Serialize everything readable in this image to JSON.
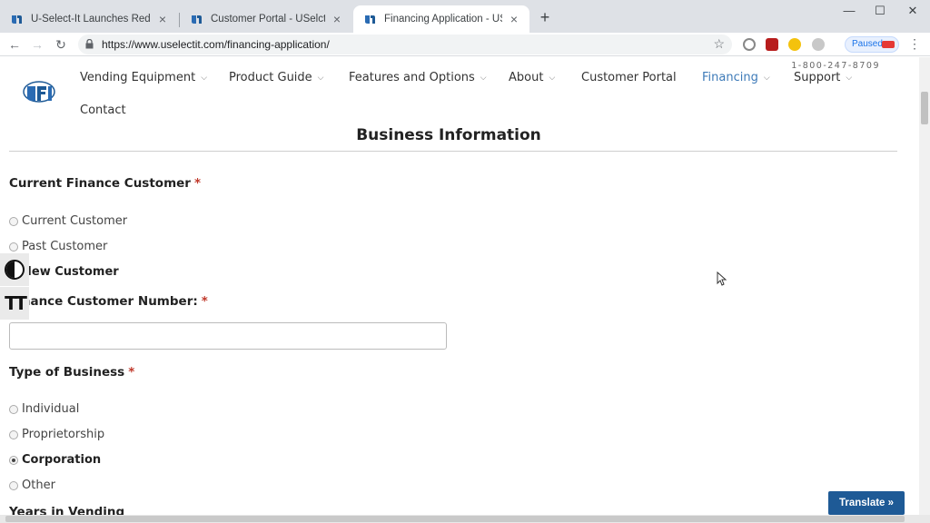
{
  "browser": {
    "tabs": [
      {
        "title": "U-Select-It Launches Redesigned",
        "active": false
      },
      {
        "title": "Customer Portal - USelctIt - Vend",
        "active": false
      },
      {
        "title": "Financing Application - USelctIt",
        "active": true
      }
    ],
    "new_tab_symbol": "+",
    "window_controls": {
      "minimize": "—",
      "maximize": "☐",
      "close": "✕"
    },
    "url": "https://www.uselectit.com/financing-application/",
    "profile_status": "Paused",
    "colors": {
      "tabstrip": "#dee1e6",
      "accent": "#1a73e8"
    }
  },
  "header": {
    "phone": "1-800-247-8709",
    "logo_name": "usi-logo",
    "nav": [
      {
        "label": "Vending Equipment",
        "has_dropdown": true
      },
      {
        "label": "Product Guide",
        "has_dropdown": true
      },
      {
        "label": "Features and Options",
        "has_dropdown": true
      },
      {
        "label": "About",
        "has_dropdown": true
      },
      {
        "label": "Customer Portal",
        "has_dropdown": false
      },
      {
        "label": "Financing",
        "has_dropdown": true,
        "active": true
      },
      {
        "label": "Support",
        "has_dropdown": true
      },
      {
        "label": "Contact",
        "has_dropdown": false
      }
    ],
    "chevron": "⌵",
    "colors": {
      "active_nav": "#3d7ab8",
      "brand": "#1e5a96"
    }
  },
  "form": {
    "section_title": "Business Information",
    "required_marker": "*",
    "current_finance_customer": {
      "label": "Current Finance Customer",
      "options": [
        {
          "label": "Current Customer",
          "selected": false
        },
        {
          "label": "Past Customer",
          "selected": false
        },
        {
          "label": "New Customer",
          "selected": true
        }
      ]
    },
    "finance_customer_number": {
      "label": "Finance Customer Number:",
      "value": ""
    },
    "type_of_business": {
      "label": "Type of Business",
      "options": [
        {
          "label": "Individual",
          "selected": false
        },
        {
          "label": "Proprietorship",
          "selected": false
        },
        {
          "label": "Corporation",
          "selected": true
        },
        {
          "label": "Other",
          "selected": false
        }
      ]
    },
    "next_label_partial": "Years in Vending"
  },
  "accessibility": {
    "contrast_icon": "contrast-icon",
    "text_size_icon": "text-size-icon"
  },
  "translate_button": "Translate »"
}
